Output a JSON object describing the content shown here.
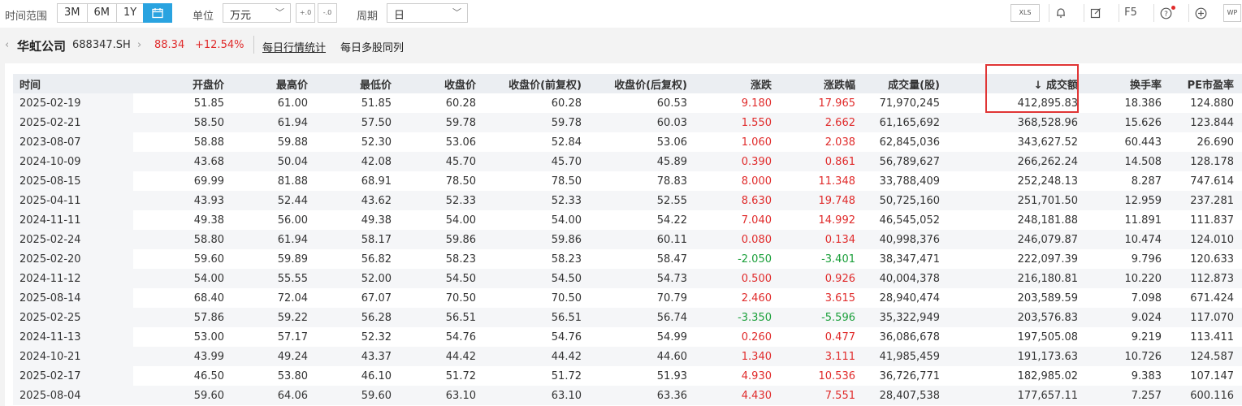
{
  "toolbar": {
    "range_label": "时间范围",
    "range_options": [
      "3M",
      "6M",
      "1Y"
    ],
    "calendar_icon": "calendar-icon",
    "unit_label": "单位",
    "unit_value": "万元",
    "decimal_increase_label": "+.0",
    "decimal_decrease_label": "-.0",
    "period_label": "周期",
    "period_value": "日",
    "excel_label": "XLS",
    "f5_label": "F5",
    "wps_label": "WP"
  },
  "stock": {
    "name": "华虹公司",
    "code": "688347.SH",
    "price": "88.34",
    "change_pct": "+12.54%",
    "tab_daily": "每日行情统计",
    "tab_multi": "每日多股同列"
  },
  "table": {
    "headers": [
      "时间",
      "开盘价",
      "最高价",
      "最低价",
      "收盘价",
      "收盘价(前复权)",
      "收盘价(后复权)",
      "涨跌",
      "涨跌幅",
      "成交量(股)",
      "↓ 成交额",
      "换手率",
      "PE市盈率"
    ],
    "rows": [
      [
        "2025-02-19",
        "51.85",
        "61.00",
        "51.85",
        "60.28",
        "60.28",
        "60.53",
        "9.180",
        "17.965",
        "71,970,245",
        "412,895.83",
        "18.386",
        "124.880"
      ],
      [
        "2025-02-21",
        "58.50",
        "61.94",
        "57.50",
        "59.78",
        "59.78",
        "60.03",
        "1.550",
        "2.662",
        "61,165,692",
        "368,528.96",
        "15.626",
        "123.844"
      ],
      [
        "2023-08-07",
        "58.88",
        "59.88",
        "52.30",
        "53.06",
        "52.84",
        "53.06",
        "1.060",
        "2.038",
        "62,845,036",
        "343,627.52",
        "60.443",
        "26.690"
      ],
      [
        "2024-10-09",
        "43.68",
        "50.04",
        "42.08",
        "45.70",
        "45.70",
        "45.89",
        "0.390",
        "0.861",
        "56,789,627",
        "266,262.24",
        "14.508",
        "128.178"
      ],
      [
        "2025-08-15",
        "69.99",
        "81.88",
        "68.91",
        "78.50",
        "78.50",
        "78.83",
        "8.000",
        "11.348",
        "33,788,409",
        "252,248.13",
        "8.287",
        "747.614"
      ],
      [
        "2025-04-11",
        "43.93",
        "52.44",
        "43.62",
        "52.33",
        "52.33",
        "52.55",
        "8.630",
        "19.748",
        "50,725,160",
        "251,701.50",
        "12.959",
        "237.281"
      ],
      [
        "2024-11-11",
        "49.38",
        "56.00",
        "49.38",
        "54.00",
        "54.00",
        "54.22",
        "7.040",
        "14.992",
        "46,545,052",
        "248,181.88",
        "11.891",
        "111.837"
      ],
      [
        "2025-02-24",
        "58.80",
        "61.94",
        "58.17",
        "59.86",
        "59.86",
        "60.11",
        "0.080",
        "0.134",
        "40,998,376",
        "246,079.87",
        "10.474",
        "124.010"
      ],
      [
        "2025-02-20",
        "59.60",
        "59.89",
        "56.82",
        "58.23",
        "58.23",
        "58.47",
        "-2.050",
        "-3.401",
        "38,347,471",
        "222,097.39",
        "9.796",
        "120.633"
      ],
      [
        "2024-11-12",
        "54.00",
        "55.55",
        "52.00",
        "54.50",
        "54.50",
        "54.73",
        "0.500",
        "0.926",
        "40,004,378",
        "216,180.81",
        "10.220",
        "112.873"
      ],
      [
        "2025-08-14",
        "68.40",
        "72.04",
        "67.07",
        "70.50",
        "70.50",
        "70.79",
        "2.460",
        "3.615",
        "28,940,474",
        "203,589.59",
        "7.098",
        "671.424"
      ],
      [
        "2025-02-25",
        "57.86",
        "59.22",
        "56.28",
        "56.51",
        "56.51",
        "56.74",
        "-3.350",
        "-5.596",
        "35,322,949",
        "203,576.83",
        "9.024",
        "117.070"
      ],
      [
        "2024-11-13",
        "53.00",
        "57.17",
        "52.32",
        "54.76",
        "54.76",
        "54.99",
        "0.260",
        "0.477",
        "36,086,678",
        "197,505.08",
        "9.219",
        "113.411"
      ],
      [
        "2024-10-21",
        "43.99",
        "49.24",
        "43.37",
        "44.42",
        "44.42",
        "44.60",
        "1.340",
        "3.111",
        "41,985,459",
        "191,173.63",
        "10.726",
        "124.587"
      ],
      [
        "2025-02-17",
        "46.50",
        "53.80",
        "46.10",
        "51.72",
        "51.72",
        "51.93",
        "4.930",
        "10.536",
        "36,726,771",
        "182,985.02",
        "9.383",
        "107.147"
      ],
      [
        "2025-08-04",
        "59.60",
        "64.06",
        "59.60",
        "63.10",
        "63.10",
        "63.36",
        "4.430",
        "7.551",
        "28,407,538",
        "177,657.11",
        "7.257",
        "600.116"
      ]
    ]
  },
  "colors": {
    "up": "#e02b2b",
    "down": "#1a9f3a",
    "accent": "#29a3e0",
    "highlight_border": "#e03535"
  }
}
